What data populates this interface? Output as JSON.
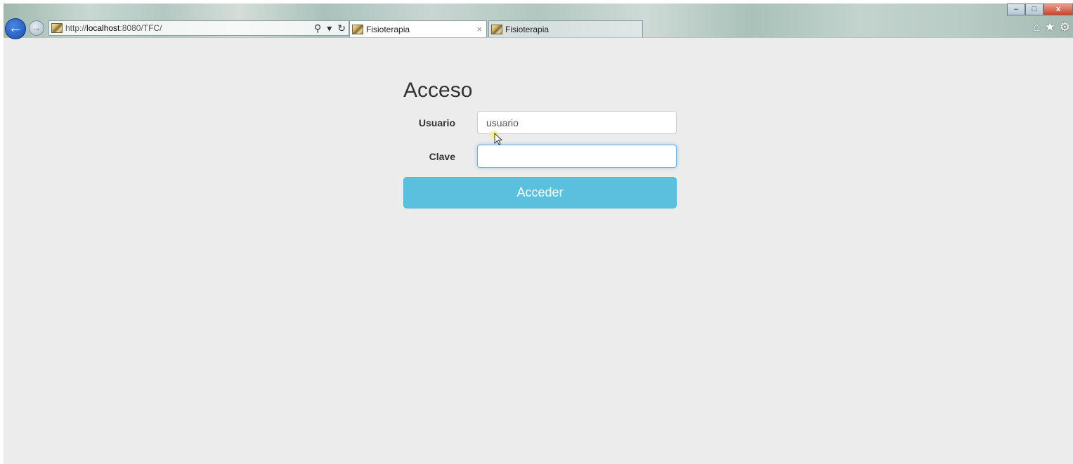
{
  "browser": {
    "url_prefix": "http://",
    "url_host": "localhost",
    "url_suffix": ":8080/TFC/",
    "tabs": [
      {
        "label": "Fisioterapia",
        "active": true
      },
      {
        "label": "Fisioterapia",
        "active": false
      }
    ],
    "icons": {
      "back": "←",
      "forward": "→",
      "search": "⚲",
      "dropdown": "▾",
      "refresh": "↻",
      "tab_close": "×",
      "minimize": "–",
      "maximize": "□",
      "close": "x",
      "home": "⌂",
      "favorites": "★",
      "settings": "⚙"
    }
  },
  "login": {
    "title": "Acceso",
    "username_label": "Usuario",
    "username_value": "usuario",
    "password_label": "Clave",
    "password_value": "",
    "submit_label": "Acceder"
  }
}
